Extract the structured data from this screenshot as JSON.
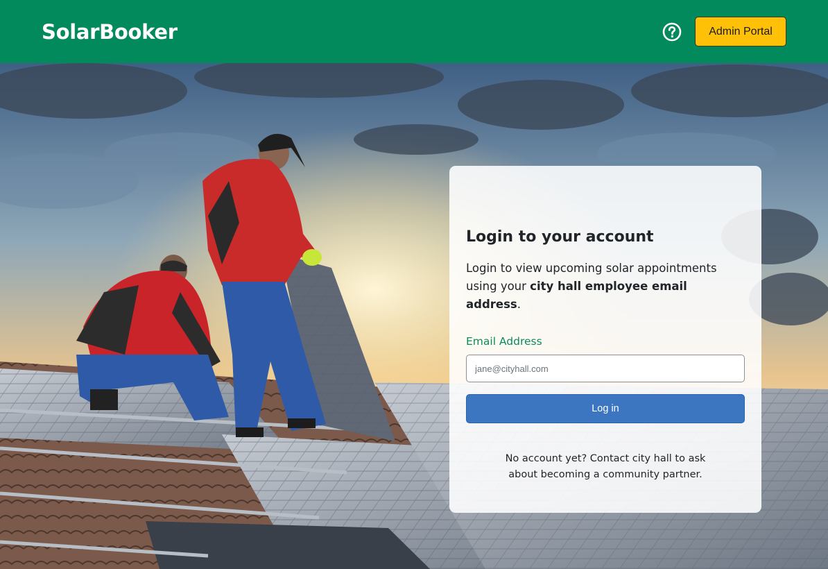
{
  "header": {
    "brand": "SolarBooker",
    "help_icon": "question-circle-icon",
    "admin_button_label": "Admin Portal"
  },
  "login": {
    "title": "Login to your account",
    "description_prefix": "Login to view upcoming solar appointments using your ",
    "description_bold": "city hall employee email address",
    "description_suffix": ".",
    "email_label": "Email Address",
    "email_placeholder": "jane@cityhall.com",
    "email_value": "",
    "submit_label": "Log in",
    "footer_text": "No account yet? Contact city hall to ask about becoming a community partner."
  },
  "colors": {
    "header_bg": "#038a5c",
    "admin_button_bg": "#ffc107",
    "login_button_bg": "#3c76c0",
    "label_green": "#0c8a5d"
  }
}
